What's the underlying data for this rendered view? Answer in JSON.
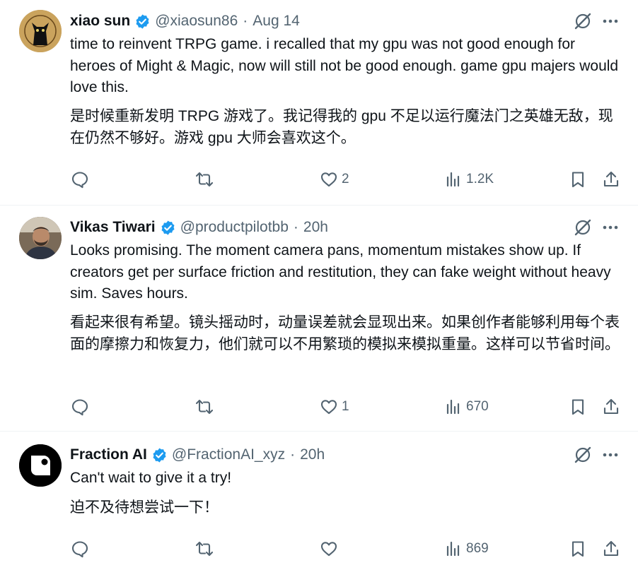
{
  "colors": {
    "text": "#0f1419",
    "secondary": "#536471",
    "verified": "#1d9bf0",
    "border": "#eff3f4"
  },
  "tweets": [
    {
      "name": "xiao sun",
      "handle": "@xiaosun86",
      "separator": "·",
      "time": "Aug 14",
      "text": "time to reinvent TRPG game. i recalled that my gpu was not good enough for heroes of Might & Magic, now will still not be good enough. game gpu majers would love this.",
      "translation": "是时候重新发明 TRPG 游戏了。我记得我的 gpu 不足以运行魔法门之英雄无敌，现在仍然不够好。游戏 gpu 大师会喜欢这个。",
      "likes": "2",
      "views": "1.2K"
    },
    {
      "name": "Vikas Tiwari",
      "handle": "@productpilotbb",
      "separator": "·",
      "time": "20h",
      "text": "Looks promising. The moment camera pans, momentum mistakes show up. If creators get per surface friction and restitution, they can fake weight without heavy sim. Saves hours.",
      "translation": "看起来很有希望。镜头摇动时，动量误差就会显现出来。如果创作者能够利用每个表面的摩擦力和恢复力，他们就可以不用繁琐的模拟来模拟重量。这样可以节省时间。",
      "likes": "1",
      "views": "670"
    },
    {
      "name": "Fraction AI",
      "handle": "@FractionAI_xyz",
      "separator": "·",
      "time": "20h",
      "text": "Can't wait to give it a try!",
      "translation": "迫不及待想尝试一下！",
      "likes": "",
      "views": "869"
    }
  ]
}
